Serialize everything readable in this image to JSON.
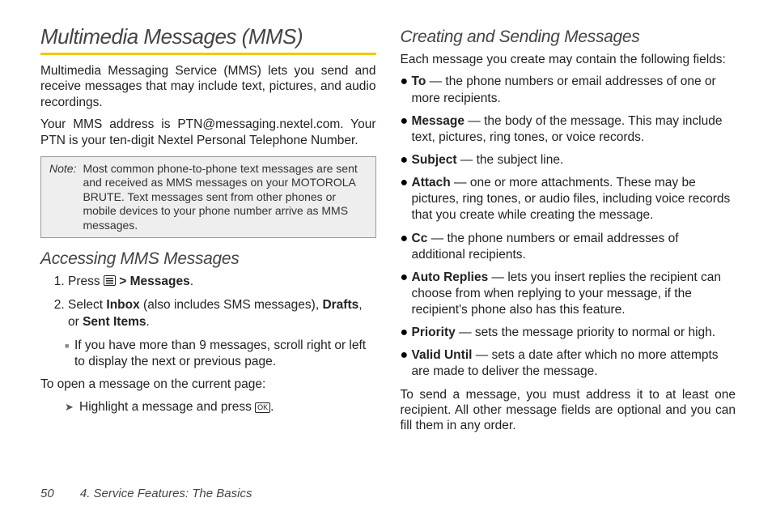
{
  "left": {
    "title": "Multimedia Messages (MMS)",
    "p1": "Multimedia Messaging Service (MMS) lets you send and receive messages that may include text, pictures, and audio recordings.",
    "p2": "Your MMS address is PTN@messaging.nextel.com. Your PTN is your ten-digit Nextel Personal Telephone Number.",
    "note_label": "Note:",
    "note_text": "Most common phone-to-phone text messages are sent and received as MMS messages on your MOTOROLA BRUTE. Text messages sent from other phones or mobile devices to your phone number arrive as MMS messages.",
    "h2": "Accessing MMS Messages",
    "step1_pre": "Press ",
    "step1_caret": " > ",
    "step1_bold": "Messages",
    "step1_post": ".",
    "step2_a": "Select ",
    "step2_b": "Inbox",
    "step2_c": " (also includes SMS messages), ",
    "step2_d": "Drafts",
    "step2_e": ", or ",
    "step2_f": "Sent Items",
    "step2_g": ".",
    "sub": "If you have more than 9 messages, scroll right or left to display the next or previous page.",
    "p3": "To open a message on the current page:",
    "arrow_a": "Highlight a message and press ",
    "arrow_b": "."
  },
  "right": {
    "h2": "Creating and Sending Messages",
    "intro": "Each message you create may contain the following fields:",
    "items": [
      {
        "label": "To",
        "text": " — the phone numbers or email addresses of one or more recipients."
      },
      {
        "label": "Message",
        "text": " — the body of the message. This may include text, pictures, ring tones, or voice records."
      },
      {
        "label": "Subject",
        "text": " — the subject line."
      },
      {
        "label": "Attach",
        "text": " — one or more attachments. These may be pictures, ring tones, or audio files, including voice records that you create while creating the message."
      },
      {
        "label": "Cc",
        "text": " — the phone numbers or email addresses of additional recipients."
      },
      {
        "label": "Auto Replies",
        "text": " — lets you insert replies the recipient can choose from when replying to your message, if the recipient's phone also has this feature."
      },
      {
        "label": "Priority",
        "text": " — sets the message priority to normal or high."
      },
      {
        "label": "Valid Until",
        "text": " — sets a date after which no more attempts are made to deliver the message."
      }
    ],
    "outro": "To send a message, you must address it to at least one recipient. All other message fields are optional and you can fill them in any order."
  },
  "footer": {
    "page": "50",
    "section": "4. Service Features: The Basics"
  },
  "icons": {
    "ok": "OK"
  }
}
